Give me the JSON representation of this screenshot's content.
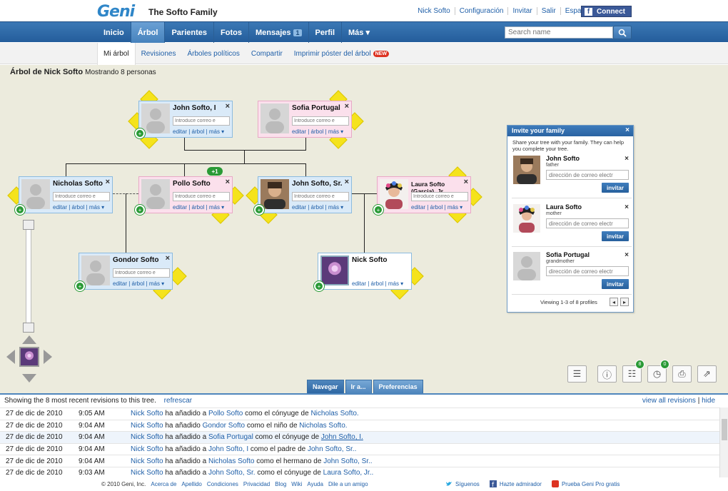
{
  "header": {
    "logo": "Geni",
    "family_title": "The Softo Family",
    "links": [
      "Nick Softo",
      "Configuración",
      "Invitar",
      "Salir",
      "Español (España) ▾"
    ],
    "connect_label": "Connect",
    "search_placeholder": "Search name"
  },
  "nav": {
    "items": [
      {
        "label": "Inicio"
      },
      {
        "label": "Árbol"
      },
      {
        "label": "Parientes"
      },
      {
        "label": "Fotos"
      },
      {
        "label": "Mensajes",
        "badge": "1"
      },
      {
        "label": "Perfil"
      },
      {
        "label": "Más ▾"
      }
    ]
  },
  "subnav": {
    "items": [
      "Mi árbol",
      "Revisiones",
      "Árboles políticos",
      "Compartir",
      "Imprimir póster del árbol"
    ],
    "new_badge": "NEW"
  },
  "tree": {
    "title": "Árbol de Nick Softo",
    "count_text": "Mostrando 8 personas",
    "plus_badge": "+1",
    "email_placeholder": "Introduce correo e",
    "actions": "editar | árbol | más ▾",
    "people": [
      {
        "name": "John Softo, I"
      },
      {
        "name": "Sofia Portugal"
      },
      {
        "name": "Nicholas Softo"
      },
      {
        "name": "Pollo Softo"
      },
      {
        "name": "John Softo, Sr."
      },
      {
        "name": "Laura Softo (Garcia), Jr."
      },
      {
        "name": "Gondor Softo"
      },
      {
        "name": "Nick Softo"
      }
    ]
  },
  "invite": {
    "title": "Invite your family",
    "description": "Share your tree with your family. They can help you complete your tree.",
    "email_placeholder": "dirección de correo electr",
    "button_label": "invitar",
    "people": [
      {
        "name": "John Softo",
        "relation": "father"
      },
      {
        "name": "Laura Softo",
        "relation": "mother"
      },
      {
        "name": "Sofia Portugal",
        "relation": "grandmother"
      }
    ],
    "footer": "Viewing 1-3 of 8 profiles"
  },
  "toolbar": {
    "badges": [
      "8",
      "0"
    ]
  },
  "bottom_tabs": [
    "Navegar",
    "Ir a...",
    "Preferencias"
  ],
  "revisions": {
    "summary": "Showing the 8 most recent revisions to this tree.",
    "refresh": "refrescar",
    "view_all": "view all revisions",
    "hide": "hide",
    "rows": [
      {
        "date": "27 de dic de 2010",
        "time": "9:05 AM",
        "actor": "Nick Softo",
        "verb": "ha añadido a",
        "subject": "Pollo Softo",
        "relation": "como el cónyuge de",
        "target": "Nicholas Softo."
      },
      {
        "date": "27 de dic de 2010",
        "time": "9:04 AM",
        "actor": "Nick Softo",
        "verb": "ha añadido",
        "subject": "Gondor Softo",
        "relation": "como el niño de",
        "target": "Nicholas Softo."
      },
      {
        "date": "27 de dic de 2010",
        "time": "9:04 AM",
        "actor": "Nick Softo",
        "verb": "ha añadido a",
        "subject": "Sofia Portugal",
        "relation": "como el cónyuge de",
        "target": "John Softo, I."
      },
      {
        "date": "27 de dic de 2010",
        "time": "9:04 AM",
        "actor": "Nick Softo",
        "verb": "ha añadido a",
        "subject": "John Softo, I",
        "relation": "como el padre de",
        "target": "John Softo, Sr.."
      },
      {
        "date": "27 de dic de 2010",
        "time": "9:04 AM",
        "actor": "Nick Softo",
        "verb": "ha añadido a",
        "subject": "Nicholas Softo",
        "relation": "como el hermano de",
        "target": "John Softo, Sr.."
      },
      {
        "date": "27 de dic de 2010",
        "time": "9:03 AM",
        "actor": "Nick Softo",
        "verb": "ha añadido a",
        "subject": "John Softo, Sr.",
        "relation": "como el cónyuge de",
        "target": "Laura Softo, Jr.."
      }
    ]
  },
  "footer": {
    "copyright": "© 2010 Geni, Inc.",
    "links": [
      "Acerca de",
      "Apellido",
      "Condiciones",
      "Privacidad",
      "Blog",
      "Wiki",
      "Ayuda",
      "Dile a un amigo"
    ],
    "social": [
      "Síguenos",
      "Hazte admirador",
      "Prueba Geni Pro gratis"
    ]
  },
  "colors": {
    "nav_blue": "#2f6aa8",
    "canvas_bg": "#ecebdd",
    "male_card": "#daeaf8",
    "female_card": "#fbe0ec",
    "accent_yellow": "#f5e31c",
    "add_green": "#2a9a36"
  }
}
